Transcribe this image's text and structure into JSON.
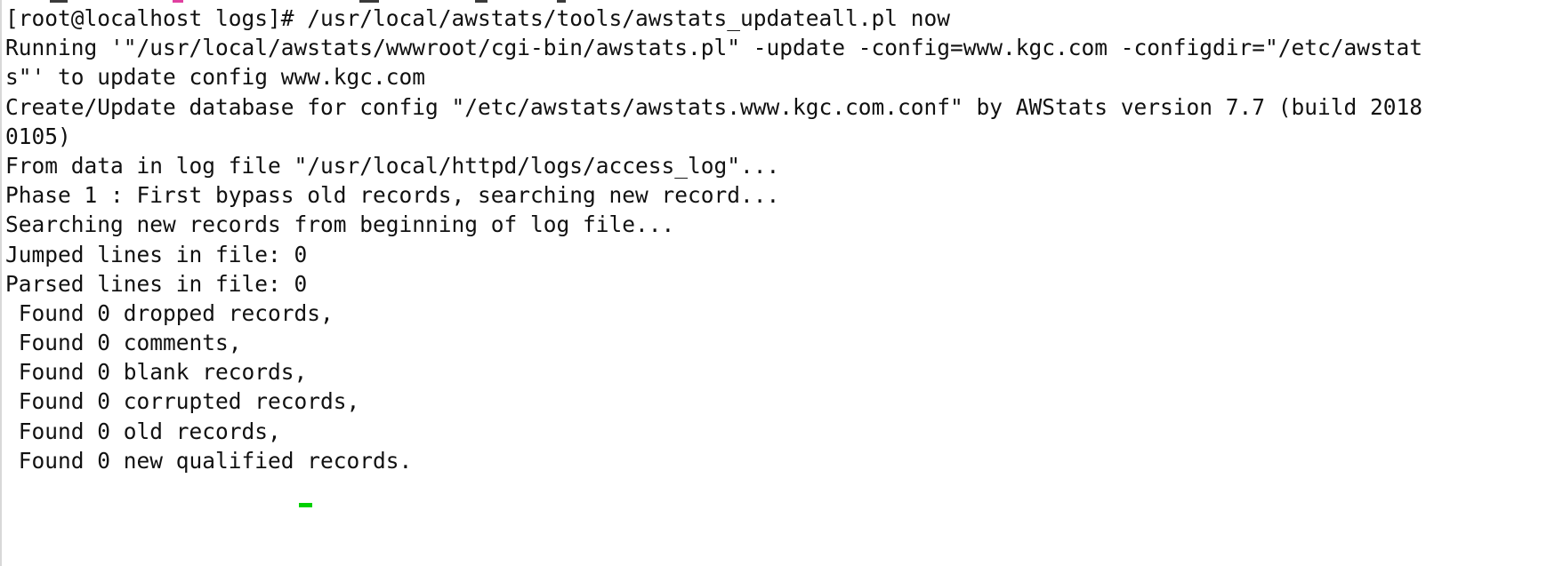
{
  "terminal": {
    "colors": {
      "background": "#ffffff",
      "text": "#111111",
      "cursor": "#00d000",
      "artifact_accent": "#e040a0"
    },
    "lines": [
      "[root@localhost logs]# /usr/local/awstats/tools/awstats_updateall.pl now",
      "Running '\"/usr/local/awstats/wwwroot/cgi-bin/awstats.pl\" -update -config=www.kgc.com -configdir=\"/etc/awstat",
      "s\"' to update config www.kgc.com",
      "Create/Update database for config \"/etc/awstats/awstats.www.kgc.com.conf\" by AWStats version 7.7 (build 2018",
      "0105)",
      "From data in log file \"/usr/local/httpd/logs/access_log\"...",
      "Phase 1 : First bypass old records, searching new record...",
      "Searching new records from beginning of log file...",
      "Jumped lines in file: 0",
      "Parsed lines in file: 0",
      " Found 0 dropped records,",
      " Found 0 comments,",
      " Found 0 blank records,",
      " Found 0 corrupted records,",
      " Found 0 old records,",
      " Found 0 new qualified records."
    ]
  }
}
